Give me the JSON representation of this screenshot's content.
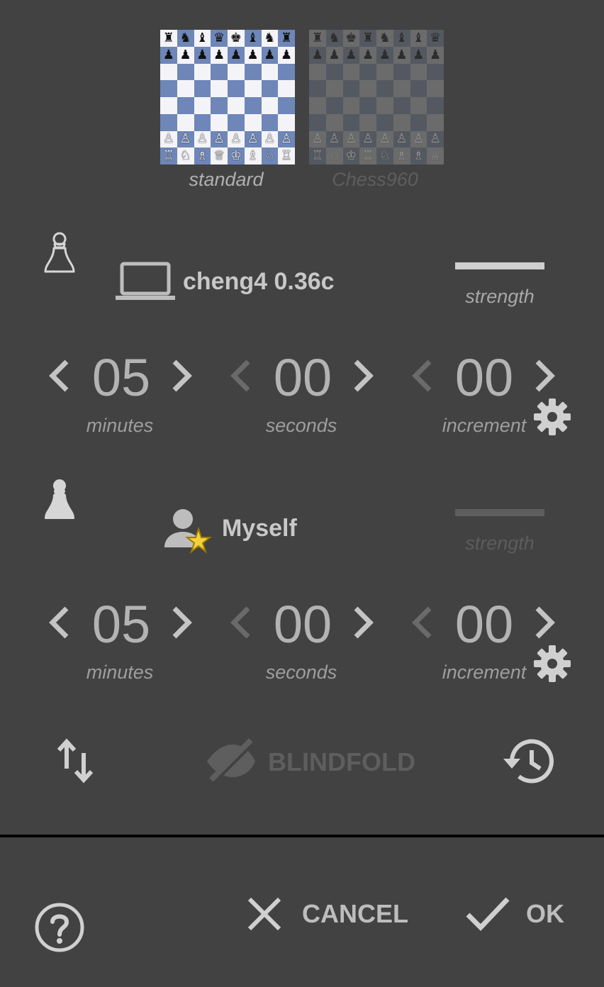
{
  "variants": [
    {
      "label": "standard",
      "selected": true
    },
    {
      "label": "Chess960",
      "selected": false
    }
  ],
  "boards": {
    "standard_rows": [
      [
        "♜",
        "♞",
        "♝",
        "♛",
        "♚",
        "♝",
        "♞",
        "♜"
      ],
      [
        "♟",
        "♟",
        "♟",
        "♟",
        "♟",
        "♟",
        "♟",
        "♟"
      ],
      [
        "",
        "",
        "",
        "",
        "",
        "",
        "",
        ""
      ],
      [
        "",
        "",
        "",
        "",
        "",
        "",
        "",
        ""
      ],
      [
        "",
        "",
        "",
        "",
        "",
        "",
        "",
        ""
      ],
      [
        "",
        "",
        "",
        "",
        "",
        "",
        "",
        ""
      ],
      [
        "♙",
        "♙",
        "♙",
        "♙",
        "♙",
        "♙",
        "♙",
        "♙"
      ],
      [
        "♖",
        "♘",
        "♗",
        "♕",
        "♔",
        "♗",
        "♘",
        "♖"
      ]
    ],
    "chess960_rows": [
      [
        "♜",
        "♞",
        "♚",
        "♜",
        "♞",
        "♝",
        "♝",
        "♛"
      ],
      [
        "♟",
        "♟",
        "♟",
        "♟",
        "♟",
        "♟",
        "♟",
        "♟"
      ],
      [
        "",
        "",
        "",
        "",
        "",
        "",
        "",
        ""
      ],
      [
        "",
        "",
        "",
        "",
        "",
        "",
        "",
        ""
      ],
      [
        "",
        "",
        "",
        "",
        "",
        "",
        "",
        ""
      ],
      [
        "",
        "",
        "",
        "",
        "",
        "",
        "",
        ""
      ],
      [
        "♙",
        "♙",
        "♙",
        "♙",
        "♙",
        "♙",
        "♙",
        "♙"
      ],
      [
        "♖",
        "♘",
        "♔",
        "♖",
        "♘",
        "♗",
        "♗",
        "♕"
      ]
    ]
  },
  "players": [
    {
      "side": "white",
      "pawn_icon": "white-pawn-icon",
      "type_icon": "laptop-icon",
      "name": "cheng4 0.36c",
      "strength_label": "strength",
      "strength_enabled": true,
      "time": {
        "minutes": "05",
        "minutes_label": "minutes",
        "seconds": "00",
        "seconds_label": "seconds",
        "increment": "00",
        "increment_label": "increment"
      }
    },
    {
      "side": "black",
      "pawn_icon": "black-pawn-icon",
      "type_icon": "user-star-icon",
      "name": "Myself",
      "strength_label": "strength",
      "strength_enabled": false,
      "time": {
        "minutes": "05",
        "minutes_label": "minutes",
        "seconds": "00",
        "seconds_label": "seconds",
        "increment": "00",
        "increment_label": "increment"
      }
    }
  ],
  "actions": {
    "swap_icon": "swap-vertical-icon",
    "blindfold_label": "BLINDFOLD",
    "blindfold_icon": "eye-off-icon",
    "history_icon": "history-icon"
  },
  "footer": {
    "help_icon": "help-circle-icon",
    "cancel_label": "CANCEL",
    "ok_label": "OK"
  },
  "colors": {
    "background": "#424242",
    "text": "#bdbdbd",
    "disabled": "#616161",
    "board_dark": "#6e86b8",
    "board_light": "#f4f4f8",
    "star": "#f4d03f"
  }
}
